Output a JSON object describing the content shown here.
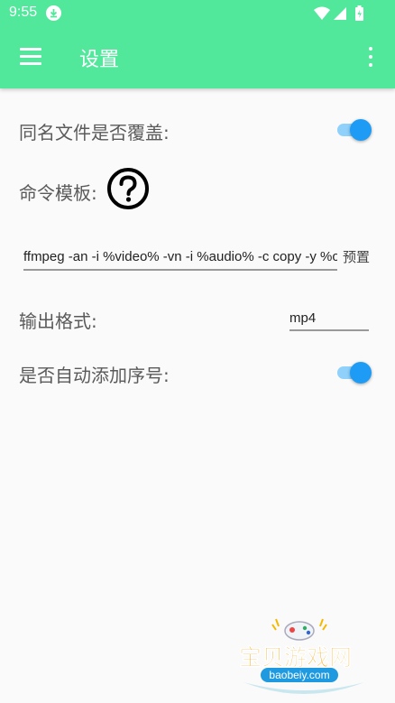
{
  "status_bar": {
    "time": "9:55"
  },
  "toolbar": {
    "title": "设置"
  },
  "settings": {
    "overwrite": {
      "label": "同名文件是否覆盖:",
      "enabled": true
    },
    "command_template": {
      "label": "命令模板:",
      "value": "ffmpeg -an -i %video% -vn -i %audio% -c copy -y %o",
      "preset_label": "预置"
    },
    "output_format": {
      "label": "输出格式:",
      "value": "mp4"
    },
    "auto_number": {
      "label": "是否自动添加序号:",
      "enabled": true
    }
  },
  "watermark": {
    "name": "宝贝游戏网",
    "site": "baobeiy.com"
  },
  "colors": {
    "appbar": "#52e89c",
    "switch_thumb": "#1e9cf5",
    "switch_track": "#8fd1fb"
  }
}
